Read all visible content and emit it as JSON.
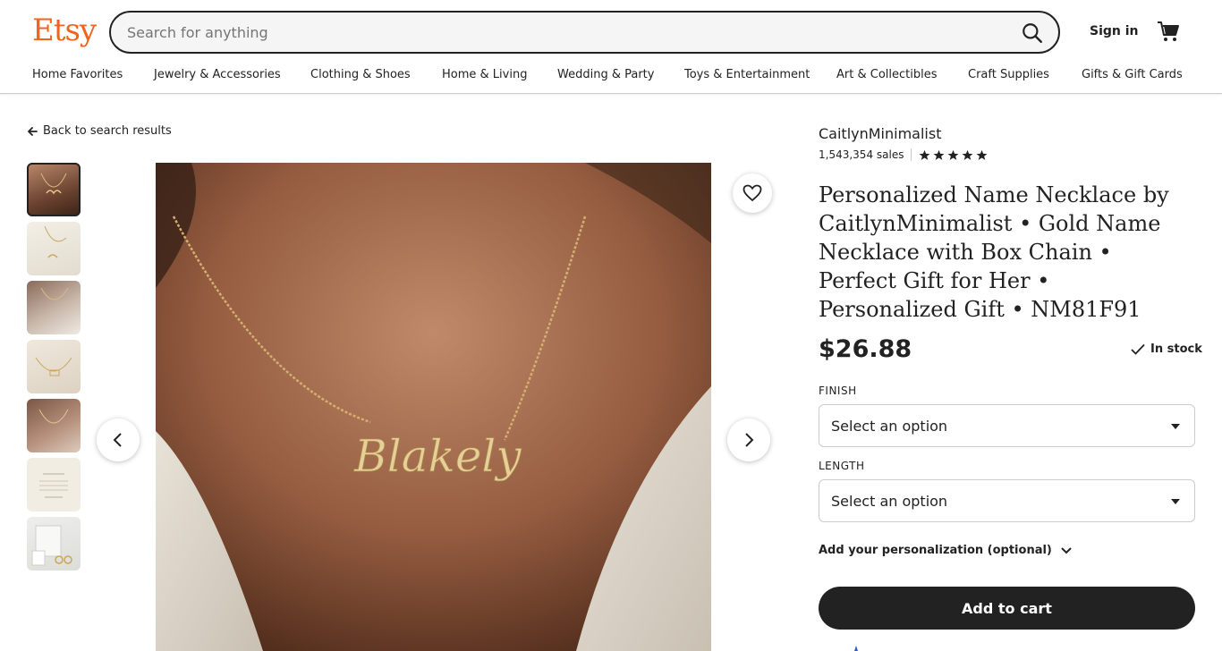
{
  "header": {
    "logo": "Etsy",
    "search_placeholder": "Search for anything",
    "signin_label": "Sign in"
  },
  "nav": [
    {
      "label": "Home Favorites"
    },
    {
      "label": "Jewelry & Accessories"
    },
    {
      "label": "Clothing & Shoes"
    },
    {
      "label": "Home & Living"
    },
    {
      "label": "Wedding & Party"
    },
    {
      "label": "Toys & Entertainment"
    },
    {
      "label": "Art & Collectibles"
    },
    {
      "label": "Craft Supplies"
    },
    {
      "label": "Gifts & Gift Cards"
    }
  ],
  "back_label": "Back to search results",
  "gallery": {
    "thumbnail_count": 7,
    "main_image_script_text": "Blakely"
  },
  "listing": {
    "shop_name": "CaitlynMinimalist",
    "sales": "1,543,354 sales",
    "rating": 5,
    "title": "Personalized Name Necklace by CaitlynMinimalist • Gold Name Necklace with Box Chain • Perfect Gift for Her • Personalized Gift • NM81F91",
    "price": "$26.88",
    "stock": "In stock",
    "finish_label": "FINISH",
    "finish_value": "Select an option",
    "length_label": "LENGTH",
    "length_value": "Select an option",
    "personalization": "Add your personalization (optional)",
    "add_to_cart": "Add to cart"
  },
  "colors": {
    "brand": "#f1641e",
    "text": "#222222",
    "button": "#222222"
  }
}
